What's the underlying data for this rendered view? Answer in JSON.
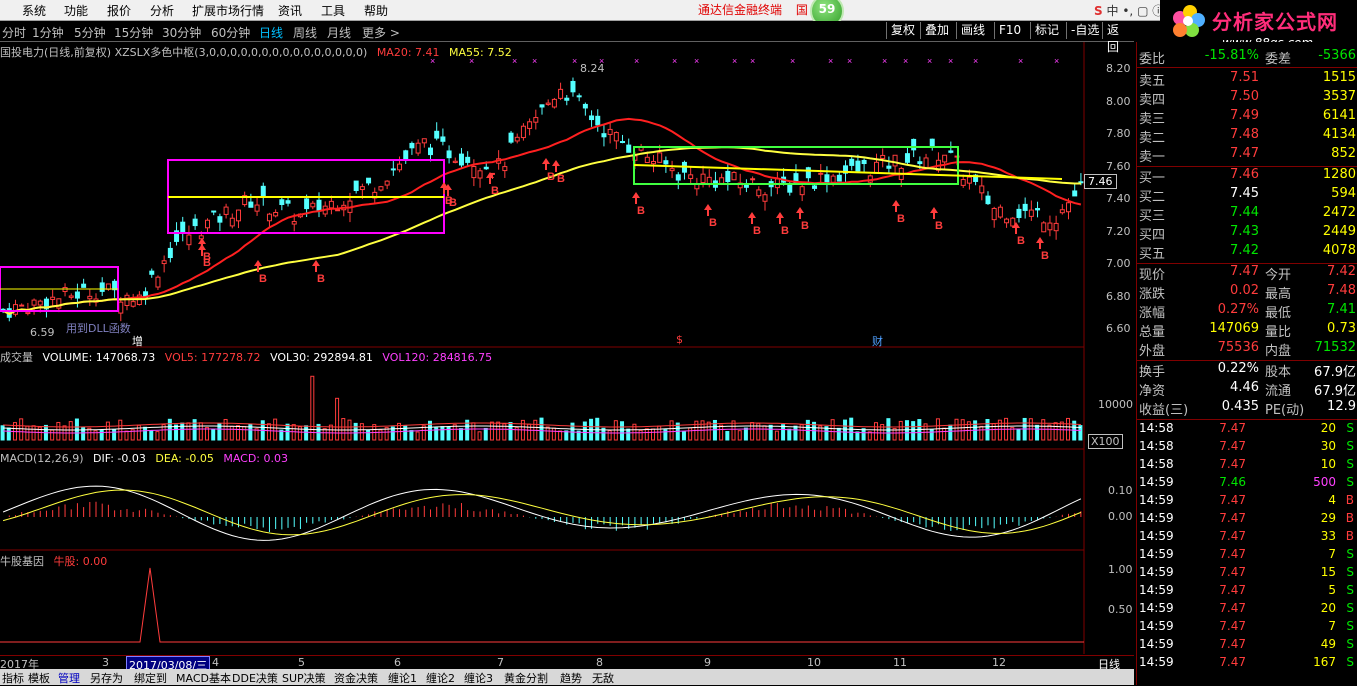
{
  "menubar": {
    "items": [
      "系统",
      "功能",
      "报价",
      "分析",
      "扩展市场行情",
      "资讯",
      "工具",
      "帮助"
    ],
    "notice": "通达信金融终端",
    "notice2": "国",
    "badge": "59",
    "logo_text": "分析家公式网",
    "logo_url": "www.88gs.com"
  },
  "periods": [
    "分时",
    "1分钟",
    "5分钟",
    "15分钟",
    "30分钟",
    "60分钟",
    "日线",
    "周线",
    "月线",
    "更多 >"
  ],
  "active_period": "日线",
  "toolbar_buttons": [
    "复权",
    "叠加",
    "画线",
    "F10",
    "标记",
    "-自选",
    "返回"
  ],
  "main_pane": {
    "title": "国投电力(日线,前复权) XZSLX多色中枢(3,0,0,0,0,0,0,0,0,0,0,0,0,0,0,0)",
    "ma20_label": "MA20: 7.41",
    "ma55_label": "MA55: 7.52",
    "high_label": "8.24",
    "low_label": "6.59",
    "dll_label": "用到DLL函数",
    "event_labels": [
      "增",
      "$",
      "财"
    ],
    "price_axis": [
      "8.20",
      "8.00",
      "7.80",
      "7.60",
      "7.40",
      "7.20",
      "7.00",
      "6.80",
      "6.60"
    ],
    "current_price_tag": "7.46"
  },
  "volume_pane": {
    "title": "成交量",
    "volume": "VOLUME: 147068.73",
    "vol5": "VOL5: 177278.72",
    "vol30": "VOL30: 292894.81",
    "vol120": "VOL120: 284816.75",
    "axis": [
      "10000"
    ],
    "unit": "X100"
  },
  "macd_pane": {
    "title": "MACD(12,26,9)",
    "dif": "DIF: -0.03",
    "dea": "DEA: -0.05",
    "macd": "MACD: 0.03",
    "axis": [
      "0.10",
      "0.00"
    ]
  },
  "gene_pane": {
    "title": "牛股基因",
    "value": "牛股: 0.00",
    "axis": [
      "1.00",
      "0.50"
    ]
  },
  "date_axis": [
    "2017年",
    "3",
    "2017/03/08/三",
    "4",
    "5",
    "6",
    "7",
    "8",
    "9",
    "10",
    "11",
    "12"
  ],
  "date_axis_right": "日线",
  "bottom_tabs": [
    "指标",
    "模板",
    "管理",
    "另存为",
    "绑定到",
    "MACD基本",
    "DDE决策",
    "SUP决策",
    "资金决策",
    "缠论1",
    "缠论2",
    "缠论3",
    "黄金分割",
    "趋势",
    "无敌"
  ],
  "quote": {
    "weibi": {
      "label": "委比",
      "value": "-15.81%",
      "label2": "委差",
      "value2": "-5366"
    },
    "sells": [
      {
        "label": "卖五",
        "price": "7.51",
        "vol": "1515"
      },
      {
        "label": "卖四",
        "price": "7.50",
        "vol": "3537"
      },
      {
        "label": "卖三",
        "price": "7.49",
        "vol": "6141"
      },
      {
        "label": "卖二",
        "price": "7.48",
        "vol": "4134"
      },
      {
        "label": "卖一",
        "price": "7.47",
        "vol": "852"
      }
    ],
    "buys": [
      {
        "label": "买一",
        "price": "7.46",
        "vol": "1280"
      },
      {
        "label": "买二",
        "price": "7.45",
        "vol": "594"
      },
      {
        "label": "买三",
        "price": "7.44",
        "vol": "2472"
      },
      {
        "label": "买四",
        "price": "7.43",
        "vol": "2449"
      },
      {
        "label": "买五",
        "price": "7.42",
        "vol": "4078"
      }
    ],
    "stats": [
      {
        "l1": "现价",
        "v1": "7.47",
        "l2": "今开",
        "v2": "7.42"
      },
      {
        "l1": "涨跌",
        "v1": "0.02",
        "l2": "最高",
        "v2": "7.48"
      },
      {
        "l1": "涨幅",
        "v1": "0.27%",
        "l2": "最低",
        "v2": "7.41"
      },
      {
        "l1": "总量",
        "v1": "147069",
        "l2": "量比",
        "v2": "0.73"
      },
      {
        "l1": "外盘",
        "v1": "75536",
        "l2": "内盘",
        "v2": "71532"
      }
    ],
    "stats2": [
      {
        "l1": "换手",
        "v1": "0.22%",
        "l2": "股本",
        "v2": "67.9亿"
      },
      {
        "l1": "净资",
        "v1": "4.46",
        "l2": "流通",
        "v2": "67.9亿"
      },
      {
        "l1": "收益(三)",
        "v1": "0.435",
        "l2": "PE(动)",
        "v2": "12.9"
      }
    ],
    "ticks": [
      {
        "time": "14:58",
        "price": "7.47",
        "vol": "20",
        "side": "S"
      },
      {
        "time": "14:58",
        "price": "7.47",
        "vol": "30",
        "side": "S"
      },
      {
        "time": "14:58",
        "price": "7.47",
        "vol": "10",
        "side": "S"
      },
      {
        "time": "14:59",
        "price": "7.46",
        "vol": "500",
        "side": "S"
      },
      {
        "time": "14:59",
        "price": "7.47",
        "vol": "4",
        "side": "B"
      },
      {
        "time": "14:59",
        "price": "7.47",
        "vol": "29",
        "side": "B"
      },
      {
        "time": "14:59",
        "price": "7.47",
        "vol": "33",
        "side": "B"
      },
      {
        "time": "14:59",
        "price": "7.47",
        "vol": "7",
        "side": "S"
      },
      {
        "time": "14:59",
        "price": "7.47",
        "vol": "15",
        "side": "S"
      },
      {
        "time": "14:59",
        "price": "7.47",
        "vol": "5",
        "side": "S"
      },
      {
        "time": "14:59",
        "price": "7.47",
        "vol": "20",
        "side": "S"
      },
      {
        "time": "14:59",
        "price": "7.47",
        "vol": "7",
        "side": "S"
      },
      {
        "time": "14:59",
        "price": "7.47",
        "vol": "49",
        "side": "S"
      },
      {
        "time": "14:59",
        "price": "7.47",
        "vol": "167",
        "side": "S"
      }
    ]
  },
  "colors": {
    "up": "#ff3c3c",
    "down": "#54ffff",
    "ma20": "#ff2020",
    "ma55": "#ffff40",
    "box_magenta": "#ff00ff",
    "box_green": "#40ff40",
    "box_yellow": "#ffff00"
  }
}
